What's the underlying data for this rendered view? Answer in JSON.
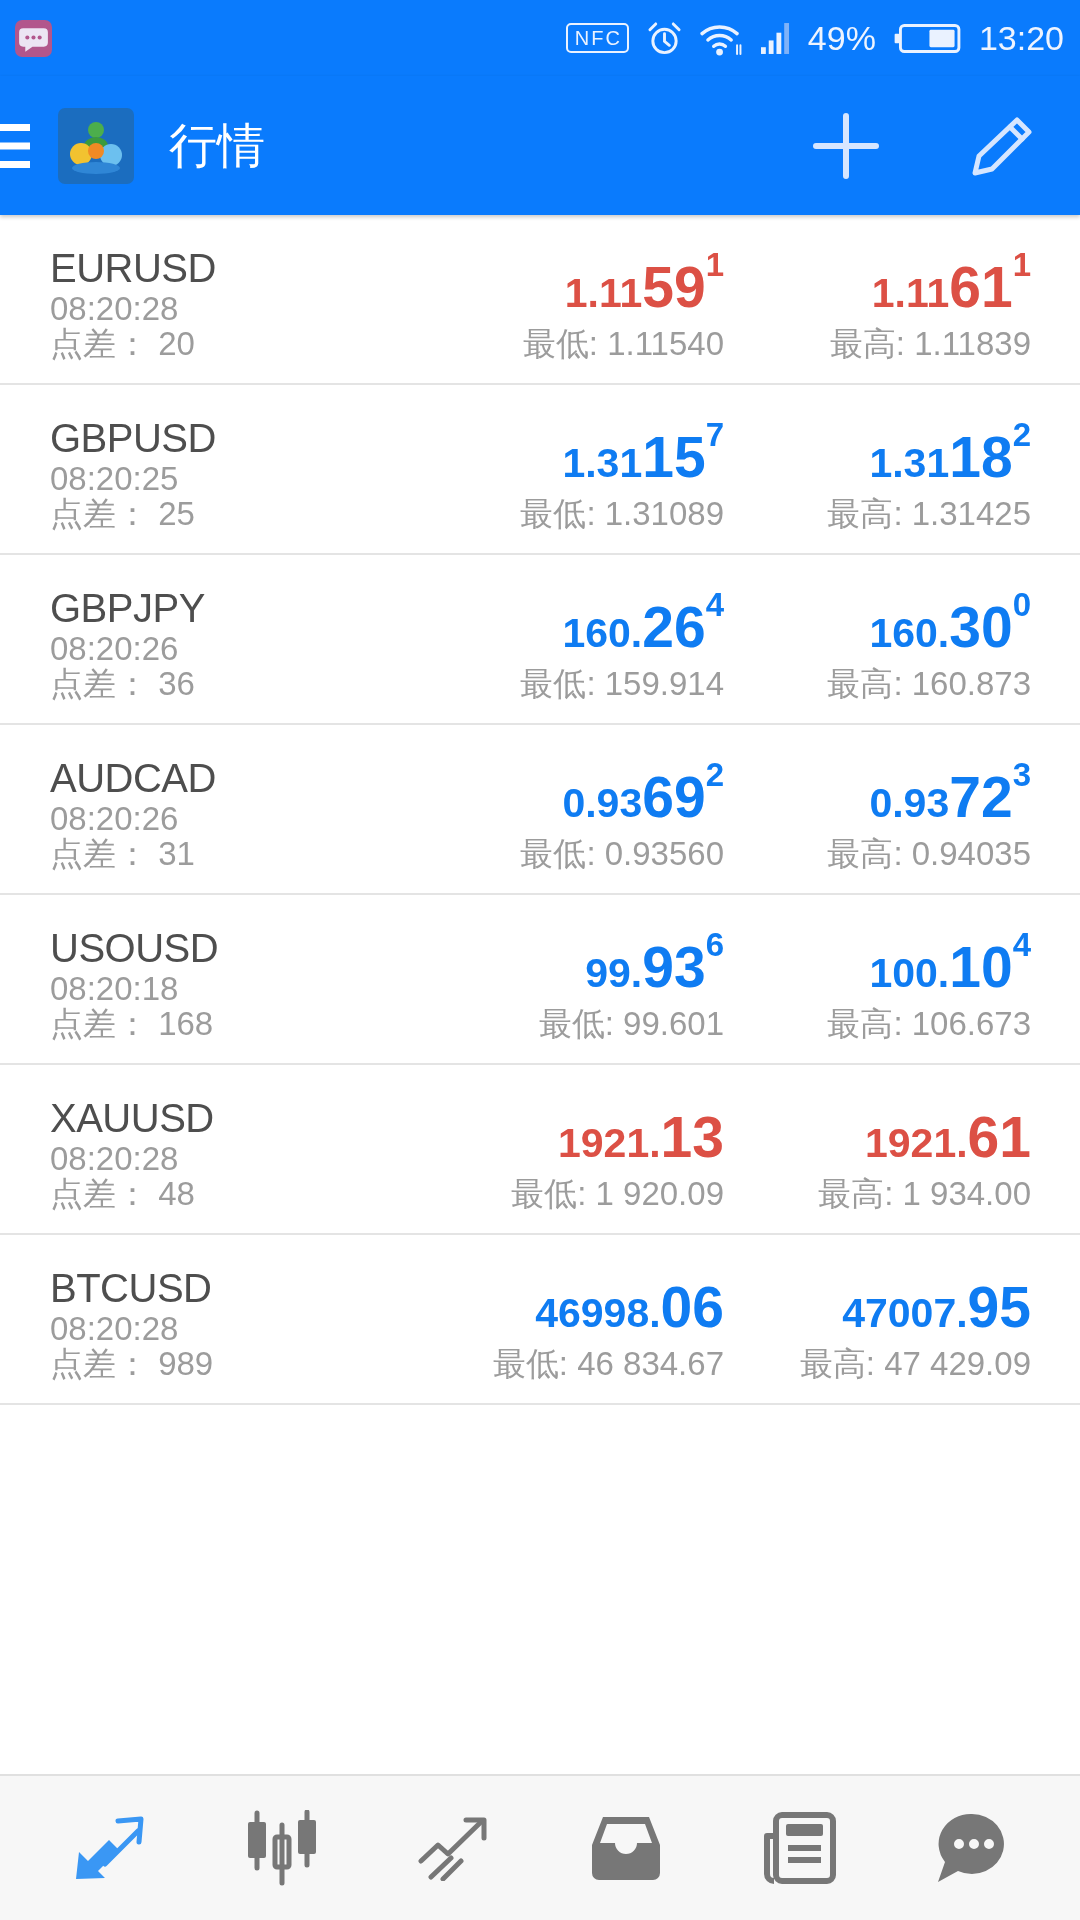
{
  "status_bar": {
    "nfc": "NFC",
    "battery": "49%",
    "time": "13:20"
  },
  "app_bar": {
    "title": "行情"
  },
  "quotes": [
    {
      "symbol": "EURUSD",
      "time": "08:20:28",
      "spread": "点差： 20",
      "bid": {
        "prefix": "1.11",
        "main": "59",
        "sup": "1",
        "color": "#dc5045"
      },
      "low": "最低: 1.11540",
      "ask": {
        "prefix": "1.11",
        "main": "61",
        "sup": "1",
        "color": "#dc5045"
      },
      "high": "最高: 1.11839"
    },
    {
      "symbol": "GBPUSD",
      "time": "08:20:25",
      "spread": "点差： 25",
      "bid": {
        "prefix": "1.31",
        "main": "15",
        "sup": "7",
        "color": "#0f7cf2"
      },
      "low": "最低: 1.31089",
      "ask": {
        "prefix": "1.31",
        "main": "18",
        "sup": "2",
        "color": "#0f7cf2"
      },
      "high": "最高: 1.31425"
    },
    {
      "symbol": "GBPJPY",
      "time": "08:20:26",
      "spread": "点差： 36",
      "bid": {
        "prefix": "160.",
        "main": "26",
        "sup": "4",
        "color": "#0f7cf2"
      },
      "low": "最低: 159.914",
      "ask": {
        "prefix": "160.",
        "main": "30",
        "sup": "0",
        "color": "#0f7cf2"
      },
      "high": "最高: 160.873"
    },
    {
      "symbol": "AUDCAD",
      "time": "08:20:26",
      "spread": "点差： 31",
      "bid": {
        "prefix": "0.93",
        "main": "69",
        "sup": "2",
        "color": "#0f7cf2"
      },
      "low": "最低: 0.93560",
      "ask": {
        "prefix": "0.93",
        "main": "72",
        "sup": "3",
        "color": "#0f7cf2"
      },
      "high": "最高: 0.94035"
    },
    {
      "symbol": "USOUSD",
      "time": "08:20:18",
      "spread": "点差： 168",
      "bid": {
        "prefix": "99.",
        "main": "93",
        "sup": "6",
        "color": "#0f7cf2"
      },
      "low": "最低: 99.601",
      "ask": {
        "prefix": "100.",
        "main": "10",
        "sup": "4",
        "color": "#0f7cf2"
      },
      "high": "最高: 106.673"
    },
    {
      "symbol": "XAUUSD",
      "time": "08:20:28",
      "spread": "点差： 48",
      "bid": {
        "prefix": "1921.",
        "main": "13",
        "color": "#dc5045"
      },
      "low": "最低: 1 920.09",
      "ask": {
        "prefix": "1921.",
        "main": "61",
        "color": "#dc5045"
      },
      "high": "最高: 1 934.00"
    },
    {
      "symbol": "BTCUSD",
      "time": "08:20:28",
      "spread": "点差： 989",
      "bid": {
        "prefix": "46998.",
        "main": "06",
        "color": "#0f7cf2"
      },
      "low": "最低: 46 834.67",
      "ask": {
        "prefix": "47007.",
        "main": "95",
        "color": "#0f7cf2"
      },
      "high": "最高: 47 429.09"
    }
  ],
  "bottom_nav": [
    {
      "kind": "arrows",
      "selected": true
    },
    {
      "kind": "candles",
      "selected": false
    },
    {
      "kind": "trend",
      "selected": false
    },
    {
      "kind": "tray",
      "selected": false
    },
    {
      "kind": "document",
      "selected": false
    },
    {
      "kind": "chat",
      "selected": false
    }
  ]
}
